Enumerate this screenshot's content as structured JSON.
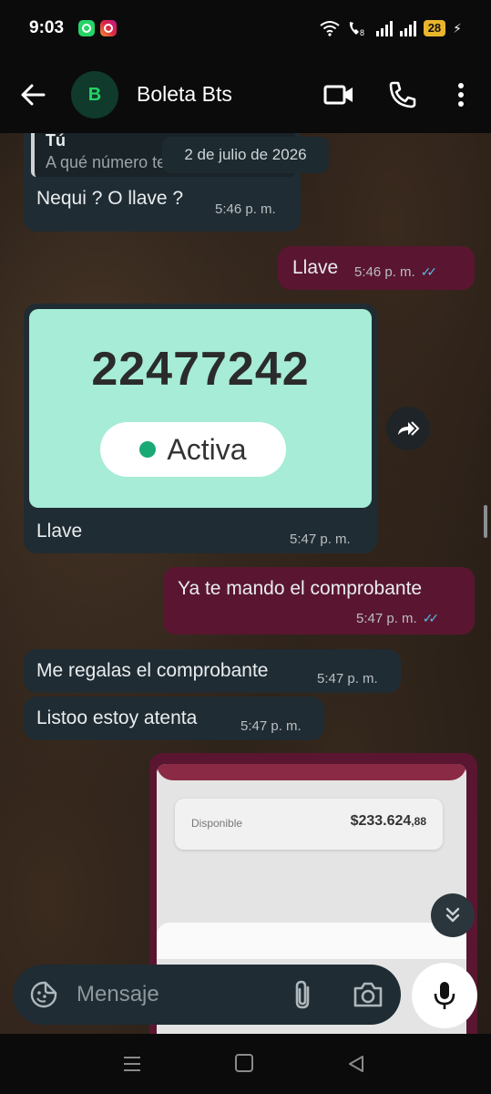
{
  "status_bar": {
    "time": "9:03",
    "battery": "28",
    "notification_icons": [
      "whatsapp-icon",
      "instagram-icon"
    ],
    "indicators": [
      "wifi-icon",
      "volte-call-icon",
      "signal-icon",
      "signal-icon",
      "battery-icon",
      "charging-icon"
    ]
  },
  "header": {
    "avatar_initial": "B",
    "contact_name": "Boleta Bts",
    "icons": [
      "back-arrow-icon",
      "video-call-icon",
      "phone-icon",
      "more-vert-icon"
    ]
  },
  "chat": {
    "date_chip": "2 de julio de 2026",
    "quoted": {
      "author": "Tú",
      "text": "A qué número te consigno?"
    },
    "messages": [
      {
        "direction": "in",
        "text": "Nequi ? O llave ?",
        "time": "5:46 p. m."
      },
      {
        "direction": "out",
        "text": "Llave",
        "time": "5:46 p. m.",
        "status": "read"
      },
      {
        "direction": "in",
        "type": "image",
        "caption": "Llave",
        "time": "5:47 p. m.",
        "image_number": "22477242",
        "image_status": "Activa"
      },
      {
        "direction": "out",
        "text": "Ya te mando el comprobante",
        "time": "5:47 p. m.",
        "status": "read"
      },
      {
        "direction": "in",
        "text": "Me regalas el comprobante",
        "time": "5:47 p. m."
      },
      {
        "direction": "in",
        "text": "Listoo estoy atenta",
        "time": "5:47 p. m."
      }
    ],
    "screenshot": {
      "label": "Disponible",
      "amount": "$233.624",
      "cents": ",88"
    }
  },
  "composer": {
    "placeholder": "Mensaje"
  },
  "colors": {
    "incoming_bubble": "#202c33",
    "outgoing_bubble": "#5a1630",
    "read_ticks": "#53bdeb",
    "accent_green": "#25d366",
    "image_bg": "#a6ecd6"
  }
}
